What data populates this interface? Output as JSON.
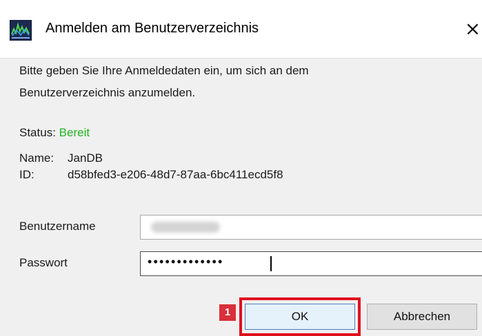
{
  "window": {
    "title": "Anmelden am Benutzerverzeichnis",
    "close_glyph": "×"
  },
  "intro": {
    "line1": "Bitte geben Sie Ihre Anmeldedaten ein, um sich an dem",
    "line2": "Benutzerverzeichnis anzumelden."
  },
  "status": {
    "label": "Status:",
    "value": "Bereit",
    "value_color": "#22b322"
  },
  "directory": {
    "name_label": "Name:",
    "name_value": "JanDB",
    "id_label": "ID:",
    "id_value": "d58bfed3-e206-48d7-87aa-6bc411ecd5f8"
  },
  "form": {
    "username_label": "Benutzername",
    "password_label": "Passwort",
    "password_mask": "•••••••••••••"
  },
  "buttons": {
    "ok_label": "OK",
    "cancel_label": "Abbrechen"
  },
  "annotation": {
    "step_number": "1",
    "highlight_color": "#e0101e",
    "marker_color": "#d9303a"
  },
  "icons": {
    "app": "app-logo-icon",
    "close": "close-icon"
  }
}
